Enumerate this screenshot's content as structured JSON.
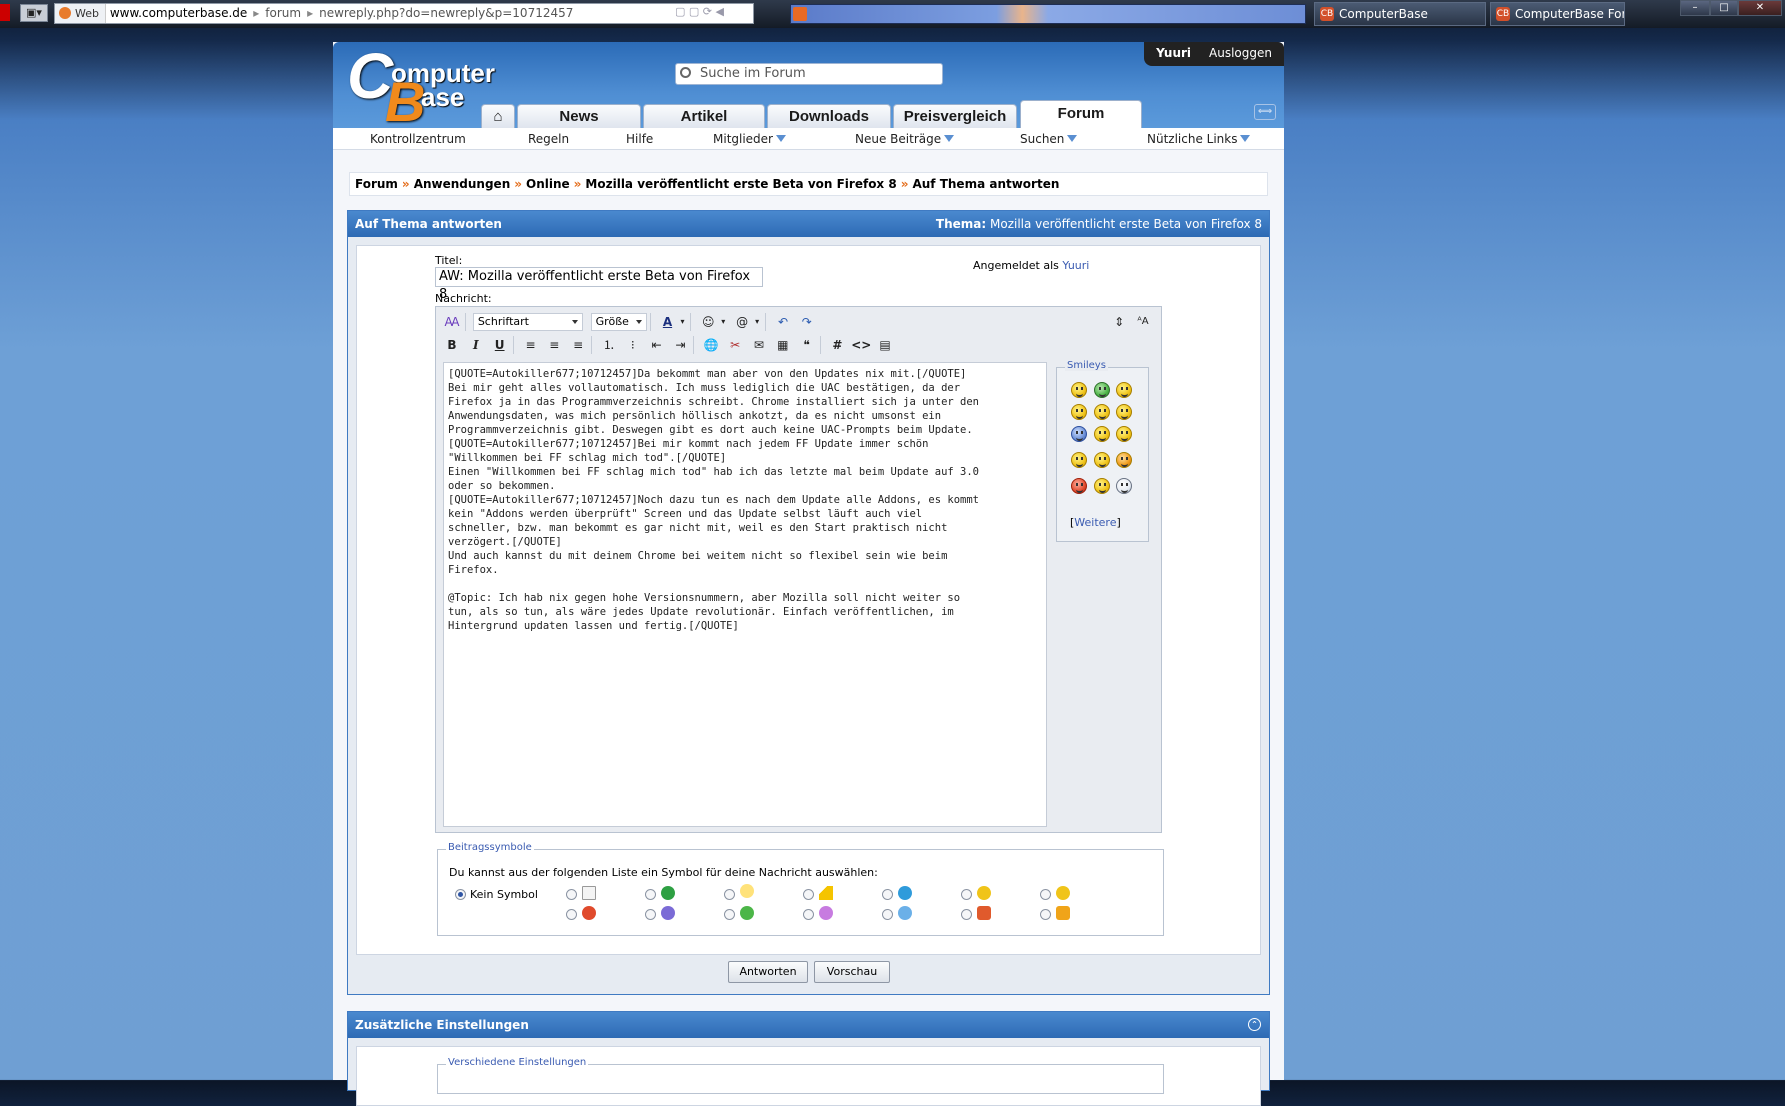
{
  "browser": {
    "search_engine": "Web",
    "url_host": "www.computerbase.de",
    "url_segment": "forum",
    "url_path": "newreply.php?do=newreply&p=10712457",
    "tabs": [
      {
        "title": "ComputerBase"
      },
      {
        "title": "ComputerBase Forum"
      }
    ],
    "window_controls": [
      "–",
      "□",
      "✕"
    ]
  },
  "site": {
    "search_placeholder": "Suche im Forum",
    "user": "Yuuri",
    "logout": "Ausloggen",
    "home_icon": "house-icon",
    "main_tabs": [
      {
        "label": "News"
      },
      {
        "label": "Artikel"
      },
      {
        "label": "Downloads"
      },
      {
        "label": "Preisvergleich"
      },
      {
        "label": "Forum"
      }
    ],
    "subnav": [
      {
        "label": "Kontrollzentrum"
      },
      {
        "label": "Regeln"
      },
      {
        "label": "Hilfe"
      },
      {
        "label": "Mitglieder"
      },
      {
        "label": "Neue Beiträge"
      },
      {
        "label": "Suchen"
      },
      {
        "label": "Nützliche Links"
      }
    ]
  },
  "breadcrumb": [
    "Forum",
    "Anwendungen",
    "Online",
    "Mozilla veröffentlicht erste Beta von Firefox 8",
    "Auf Thema antworten"
  ],
  "reply": {
    "heading": "Auf Thema antworten",
    "thread_label": "Thema:",
    "thread_title": "Mozilla veröffentlicht erste Beta von Firefox 8",
    "title_label": "Titel:",
    "title_value": "AW: Mozilla veröffentlicht erste Beta von Firefox 8",
    "logged_in_as": "Angemeldet als",
    "logged_in_user": "Yuuri",
    "message_label": "Nachricht:",
    "font_select": "Schriftart",
    "size_select": "Größe",
    "message": "[QUOTE=Autokiller677;10712457]Da bekommt man aber von den Updates nix mit.[/QUOTE]\nBei mir geht alles vollautomatisch. Ich muss lediglich die UAC bestätigen, da der\nFirefox ja in das Programmverzeichnis schreibt. Chrome installiert sich ja unter den\nAnwendungsdaten, was mich persönlich höllisch ankotzt, da es nicht umsonst ein\nProgrammverzeichnis gibt. Deswegen gibt es dort auch keine UAC-Prompts beim Update.\n[QUOTE=Autokiller677;10712457]Bei mir kommt nach jedem FF Update immer schön\n\"Willkommen bei FF schlag mich tod\".[/QUOTE]\nEinen \"Willkommen bei FF schlag mich tod\" hab ich das letzte mal beim Update auf 3.0\noder so bekommen.\n[QUOTE=Autokiller677;10712457]Noch dazu tun es nach dem Update alle Addons, es kommt\nkein \"Addons werden überprüft\" Screen und das Update selbst läuft auch viel\nschneller, bzw. man bekommt es gar nicht mit, weil es den Start praktisch nicht\nverzögert.[/QUOTE]\nUnd auch kannst du mit deinem Chrome bei weitem nicht so flexibel sein wie beim\nFirefox.\n\n@Topic: Ich hab nix gegen hohe Versionsnummern, aber Mozilla soll nicht weiter so\ntun, als so tun, als wäre jedes Update revolutionär. Einfach veröffentlichen, im\nHintergrund updaten lassen und fertig.[/QUOTE]",
    "smilies_legend": "Smileys",
    "smilies_more": "Weitere",
    "icons_legend": "Beitragssymbole",
    "icons_desc": "Du kannst aus der folgenden Liste ein Symbol für deine Nachricht auswählen:",
    "no_symbol": "Kein Symbol",
    "submit": "Antworten",
    "preview": "Vorschau"
  },
  "extra": {
    "heading": "Zusätzliche Einstellungen",
    "legend": "Verschiedene Einstellungen"
  },
  "colors": {
    "accent": "#2d6ab4",
    "link": "#3a5bb1",
    "breadcrumb_arrow": "#e46d1b",
    "logo_orange": "#f08a1c"
  }
}
